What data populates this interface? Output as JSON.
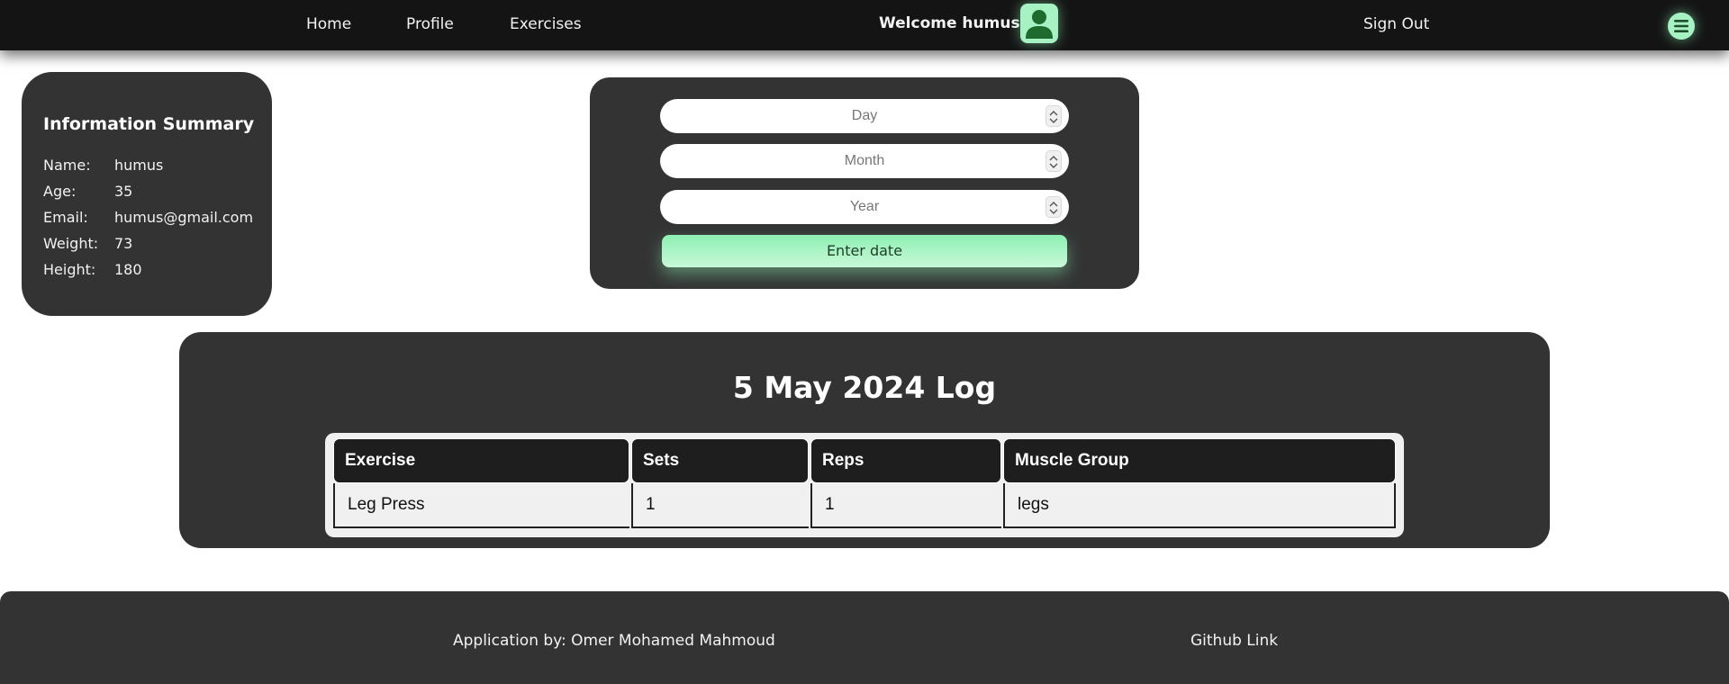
{
  "nav": {
    "links": [
      "Home",
      "Profile",
      "Exercises"
    ],
    "welcome": "Welcome humus",
    "sign_out": "Sign Out"
  },
  "colors": {
    "accent": "#a6f2c2",
    "card_bg": "#333333",
    "topbar_bg": "#141414"
  },
  "icons": {
    "avatar": "user-avatar-icon",
    "menu": "hamburger-menu-icon"
  },
  "info": {
    "title": "Information Summary",
    "rows": [
      {
        "label": "Name:",
        "value": "humus"
      },
      {
        "label": "Age:",
        "value": "35"
      },
      {
        "label": "Email:",
        "value": "humus@gmail.com"
      },
      {
        "label": "Weight:",
        "value": "73"
      },
      {
        "label": "Height:",
        "value": "180"
      }
    ]
  },
  "date_form": {
    "day_placeholder": "Day",
    "month_placeholder": "Month",
    "year_placeholder": "Year",
    "submit_label": "Enter date"
  },
  "log": {
    "title": "5 May 2024 Log",
    "columns": [
      "Exercise",
      "Sets",
      "Reps",
      "Muscle Group"
    ],
    "rows": [
      [
        "Leg Press",
        "1",
        "1",
        "legs"
      ]
    ]
  },
  "footer": {
    "credit": "Application by: Omer Mohamed Mahmoud",
    "github": "Github Link"
  }
}
